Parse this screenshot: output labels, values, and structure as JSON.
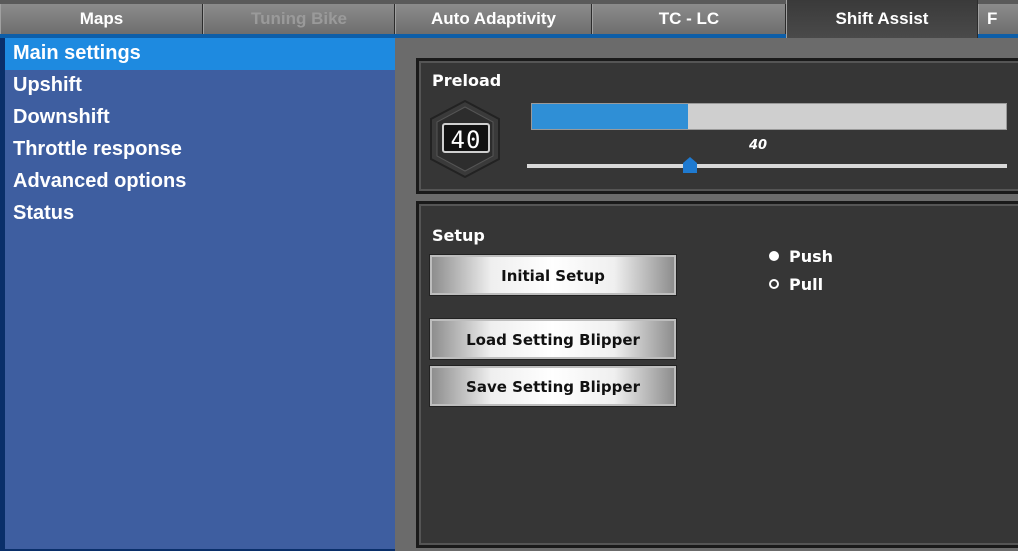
{
  "tabs": [
    {
      "label": "Maps",
      "state": "normal"
    },
    {
      "label": "Tuning Bike",
      "state": "disabled"
    },
    {
      "label": "Auto Adaptivity",
      "state": "normal"
    },
    {
      "label": "TC - LC",
      "state": "normal"
    },
    {
      "label": "Shift Assist",
      "state": "active"
    },
    {
      "label": "F",
      "state": "normal"
    }
  ],
  "sidebar": {
    "items": [
      {
        "label": "Main settings",
        "selected": true
      },
      {
        "label": "Upshift",
        "selected": false
      },
      {
        "label": "Downshift",
        "selected": false
      },
      {
        "label": "Throttle response",
        "selected": false
      },
      {
        "label": "Advanced options",
        "selected": false
      },
      {
        "label": "Status",
        "selected": false
      }
    ]
  },
  "preload": {
    "title": "Preload",
    "display": "40",
    "value_label": "40",
    "fill_fraction": 0.33,
    "slider_fraction": 0.34
  },
  "setup": {
    "title": "Setup",
    "buttons": {
      "initial": "Initial Setup",
      "load": "Load Setting Blipper",
      "save": "Save Setting Blipper"
    },
    "radio": [
      {
        "label": "Push",
        "checked": true
      },
      {
        "label": "Pull",
        "checked": false
      }
    ]
  },
  "colors": {
    "accent_blue": "#2f8fd6",
    "sidebar_bg": "#3e5ea0",
    "sidebar_selected": "#1e8ae0"
  }
}
